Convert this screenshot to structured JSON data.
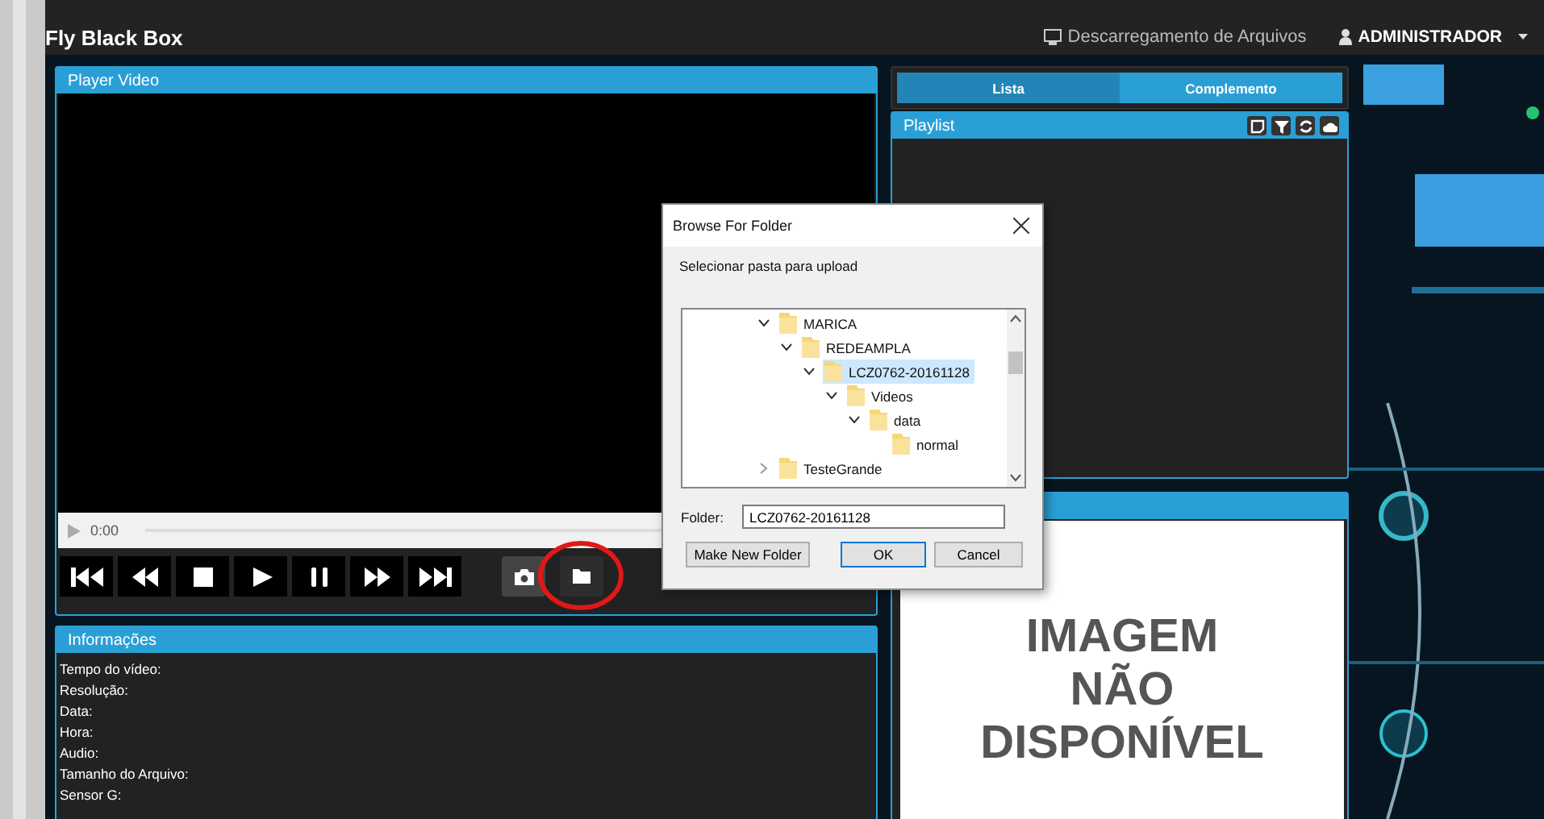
{
  "app": {
    "title": "Fly Black Box",
    "nav": [
      {
        "kind": "download",
        "label": "Descarregamento de Arquivos"
      },
      {
        "kind": "user",
        "label": "ADMINISTRADOR"
      }
    ]
  },
  "player": {
    "title": "Player Video",
    "time": "0:00",
    "controls": [
      {
        "kind": "first"
      },
      {
        "kind": "rewind"
      },
      {
        "kind": "stop"
      },
      {
        "kind": "play"
      },
      {
        "kind": "pause"
      },
      {
        "kind": "forward"
      },
      {
        "kind": "last"
      }
    ],
    "tools": [
      {
        "kind": "camera",
        "highlighted": false
      },
      {
        "kind": "folder",
        "highlighted": true
      }
    ]
  },
  "info": {
    "title": "Informações",
    "fields": [
      "Tempo do vídeo:",
      "Resolução:",
      "Data:",
      "Hora:",
      "Audio:",
      "Tamanho do Arquivo:",
      "Sensor G:"
    ]
  },
  "tabs": [
    {
      "label": "Lista",
      "selected": true
    },
    {
      "label": "Complemento",
      "selected": false
    }
  ],
  "playlist": {
    "title": "Playlist",
    "tools": [
      {
        "kind": "note"
      },
      {
        "kind": "filter"
      },
      {
        "kind": "refresh"
      },
      {
        "kind": "upload"
      }
    ]
  },
  "image_panel": {
    "message": [
      "IMAGEM",
      "NÃO",
      "DISPONÍVEL"
    ]
  },
  "dialog": {
    "title": "Browse For Folder",
    "prompt": "Selecionar pasta para upload",
    "tree": [
      {
        "label": "MARICA",
        "expanded": true,
        "selected": false,
        "children": [
          {
            "label": "REDEAMPLA",
            "expanded": true,
            "selected": false,
            "children": [
              {
                "label": "LCZ0762-20161128",
                "expanded": true,
                "selected": true,
                "children": [
                  {
                    "label": "Videos",
                    "expanded": true,
                    "selected": false,
                    "children": [
                      {
                        "label": "data",
                        "expanded": true,
                        "selected": false,
                        "children": [
                          {
                            "label": "normal",
                            "selected": false
                          }
                        ]
                      }
                    ]
                  }
                ]
              }
            ]
          }
        ]
      },
      {
        "label": "TesteGrande",
        "expanded": false,
        "selected": false
      }
    ],
    "folder_label": "Folder:",
    "folder_value": "LCZ0762-20161128",
    "buttons": [
      {
        "label": "Make New Folder",
        "kind": "secondary"
      },
      {
        "label": "OK",
        "kind": "default"
      },
      {
        "label": "Cancel",
        "kind": "secondary"
      }
    ]
  }
}
